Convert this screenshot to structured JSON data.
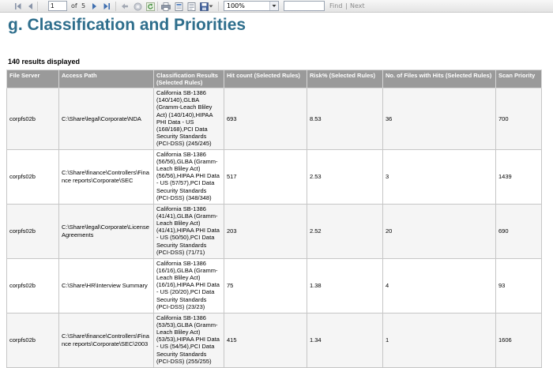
{
  "toolbar": {
    "page_value": "1",
    "of_label": "of",
    "total_pages": "5",
    "zoom_value": "100%",
    "find_label": "Find",
    "separator": "|",
    "next_label": "Next",
    "icons": [
      "first-page-icon",
      "previous-page-icon",
      "next-page-icon",
      "last-page-icon",
      "back-icon",
      "stop-icon",
      "refresh-icon",
      "print-icon",
      "print-layout-icon",
      "page-setup-icon",
      "export-icon",
      "export-dropdown-icon"
    ]
  },
  "report": {
    "title": "g. Classification and Priorities",
    "results_text": "140 results displayed"
  },
  "table": {
    "headers": {
      "file_server": "File Server",
      "access_path": "Access Path",
      "classification": "Classification Results (Selected Rules)",
      "hit_count": "Hit count (Selected Rules)",
      "risk": "Risk% (Selected Rules)",
      "files_hits": "No. of Files with Hits (Selected Rules)",
      "scan_priority": "Scan Priority"
    },
    "rows": [
      {
        "file_server": "corpfs02b",
        "access_path": "C:\\Share\\legal\\Corporate\\NDA",
        "classification": "California SB-1386 (140/140),GLBA (Gramm-Leach Bliley Act) (140/140),HIPAA PHI Data - US (168/168),PCI Data Security Standards (PCI-DSS) (245/245)",
        "hit_count": "693",
        "risk": "8.53",
        "files_hits": "36",
        "scan_priority": "700"
      },
      {
        "file_server": "corpfs02b",
        "access_path": "C:\\Share\\finance\\Controllers\\Finance reports\\Corporate\\SEC",
        "classification": "California SB-1386 (56/56),GLBA (Gramm-Leach Bliley Act) (56/56),HIPAA PHI Data - US (57/57),PCI Data Security Standards (PCI-DSS) (348/348)",
        "hit_count": "517",
        "risk": "2.53",
        "files_hits": "3",
        "scan_priority": "1439"
      },
      {
        "file_server": "corpfs02b",
        "access_path": "C:\\Share\\legal\\Corporate\\License Agreements",
        "classification": "California SB-1386 (41/41),GLBA (Gramm-Leach Bliley Act) (41/41),HIPAA PHI Data - US (50/50),PCI Data Security Standards (PCI-DSS) (71/71)",
        "hit_count": "203",
        "risk": "2.52",
        "files_hits": "20",
        "scan_priority": "690"
      },
      {
        "file_server": "corpfs02b",
        "access_path": "C:\\Share\\HR\\Interview Summary",
        "classification": "California SB-1386 (16/16),GLBA (Gramm-Leach Bliley Act) (16/16),HIPAA PHI Data - US (20/20),PCI Data Security Standards (PCI-DSS) (23/23)",
        "hit_count": "75",
        "risk": "1.38",
        "files_hits": "4",
        "scan_priority": "93"
      },
      {
        "file_server": "corpfs02b",
        "access_path": "C:\\Share\\finance\\Controllers\\Finance reports\\Corporate\\SEC\\2003",
        "classification": "California SB-1386 (53/53),GLBA (Gramm-Leach Bliley Act) (53/53),HIPAA PHI Data - US (54/54),PCI Data Security Standards (PCI-DSS) (255/255)",
        "hit_count": "415",
        "risk": "1.34",
        "files_hits": "1",
        "scan_priority": "1606"
      }
    ]
  }
}
